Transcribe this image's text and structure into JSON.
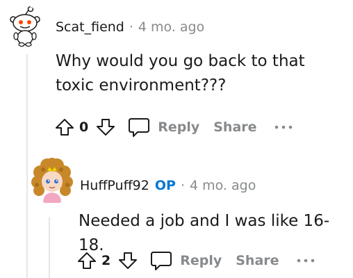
{
  "comments": [
    {
      "username": "Scat_fiend",
      "separator": "·",
      "timestamp": "4 mo. ago",
      "body": "Why would you go back to that toxic environment???",
      "score": "0",
      "reply_label": "Reply",
      "share_label": "Share",
      "avatar_icon": "snoo-avatar-icon"
    },
    {
      "username": "HuffPuff92",
      "op_badge": "OP",
      "separator": "·",
      "timestamp": "4 mo. ago",
      "body": "Needed a job and I was like 16-18.",
      "score": "2",
      "reply_label": "Reply",
      "share_label": "Share",
      "avatar_icon": "curly-hair-avatar-icon"
    }
  ],
  "colors": {
    "text": "#1a1a1b",
    "muted": "#878a8c",
    "op_blue": "#0079d3",
    "thread_line": "#e6e6e6"
  }
}
